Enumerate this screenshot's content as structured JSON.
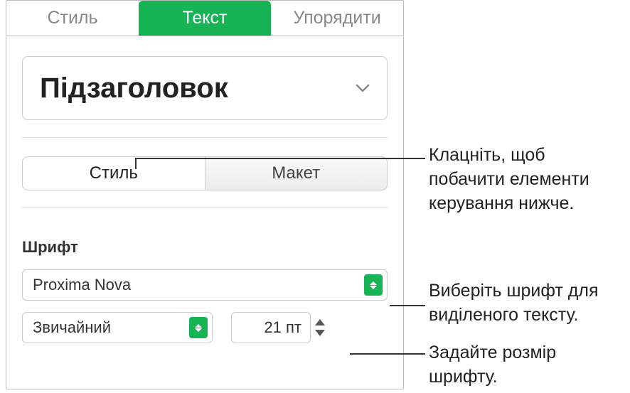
{
  "topTabs": {
    "style": "Стиль",
    "text": "Текст",
    "arrange": "Упорядити"
  },
  "paragraphStyle": "Підзаголовок",
  "seg": {
    "style": "Стиль",
    "layout": "Макет"
  },
  "fontSection": "Шрифт",
  "fontFamily": "Proxima Nova",
  "typeface": "Звичайний",
  "fontSize": "21 пт",
  "callouts": {
    "seg": "Клацніть, щоб побачити елементи керування нижче.",
    "font": "Виберіть шрифт для виділеного тексту.",
    "size": "Задайте розмір шрифту."
  }
}
